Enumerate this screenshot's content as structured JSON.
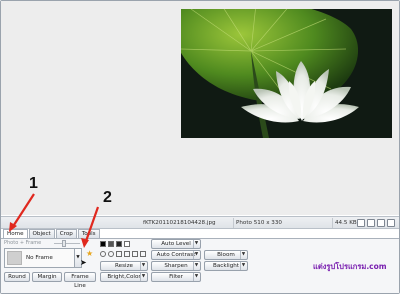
{
  "status": {
    "filename": "fKTK20110218104428.jpg",
    "photo_info": "Photo 510 x 330",
    "file_size": "44.5 KB"
  },
  "tabs": [
    {
      "label": "Home",
      "active": true
    },
    {
      "label": "Object",
      "active": false
    },
    {
      "label": "Crop",
      "active": false
    },
    {
      "label": "Tools",
      "active": false
    }
  ],
  "frame_panel": {
    "header": "Photo + Frame",
    "selected": "No Frame",
    "buttons": [
      "Round",
      "Margin",
      "Frame Line"
    ]
  },
  "adjust": {
    "col1": [
      "Resize",
      "Bright,Color"
    ],
    "col2": [
      "Auto Level",
      "Auto Contrast",
      "Sharpen",
      "Filter"
    ],
    "col3": [
      "Bloom",
      "Backlight"
    ]
  },
  "watermark": "แต่งรูปโปรแกรม.com",
  "annotations": [
    "1",
    "2"
  ],
  "colors": {
    "accent": "#7a20b0",
    "arrow": "#e0281e"
  }
}
